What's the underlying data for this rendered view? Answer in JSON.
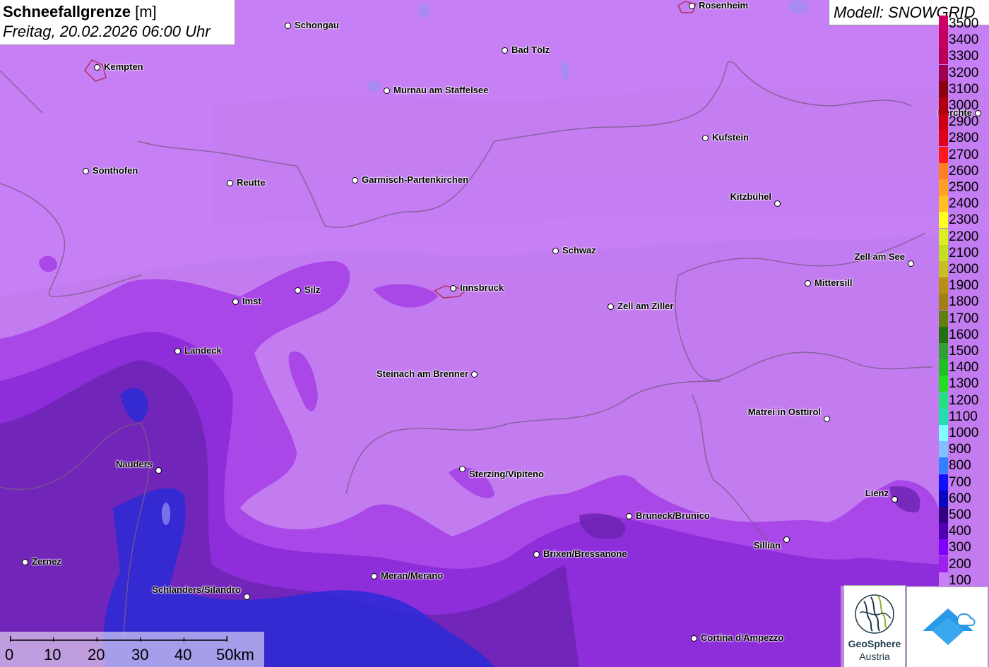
{
  "title": {
    "main": "Schneefallgrenze",
    "unit": "[m]",
    "datetime": "Freitag, 20.02.2026 06:00 Uhr"
  },
  "model": {
    "label": "Modell: SNOWGRID"
  },
  "legend": {
    "items": [
      {
        "label": "3500",
        "color": "#cc0066"
      },
      {
        "label": "3400",
        "color": "#c4005e"
      },
      {
        "label": "3300",
        "color": "#b80058"
      },
      {
        "label": "3200",
        "color": "#a00050"
      },
      {
        "label": "3100",
        "color": "#8a0010"
      },
      {
        "label": "3000",
        "color": "#b00010"
      },
      {
        "label": "2900",
        "color": "#cc0010"
      },
      {
        "label": "2800",
        "color": "#e00018"
      },
      {
        "label": "2700",
        "color": "#ff1a1a"
      },
      {
        "label": "2600",
        "color": "#ff8020"
      },
      {
        "label": "2500",
        "color": "#ffa020"
      },
      {
        "label": "2400",
        "color": "#ffc020"
      },
      {
        "label": "2300",
        "color": "#ffff20"
      },
      {
        "label": "2200",
        "color": "#d8f020"
      },
      {
        "label": "2100",
        "color": "#c0e020"
      },
      {
        "label": "2000",
        "color": "#c8c020"
      },
      {
        "label": "1900",
        "color": "#b89010"
      },
      {
        "label": "1800",
        "color": "#a08010"
      },
      {
        "label": "1700",
        "color": "#608010"
      },
      {
        "label": "1600",
        "color": "#207010"
      },
      {
        "label": "1500",
        "color": "#30a030"
      },
      {
        "label": "1400",
        "color": "#20c020"
      },
      {
        "label": "1300",
        "color": "#20e020"
      },
      {
        "label": "1200",
        "color": "#20e080"
      },
      {
        "label": "1100",
        "color": "#20e0b0"
      },
      {
        "label": "1000",
        "color": "#80ffff"
      },
      {
        "label": "900",
        "color": "#80c0ff"
      },
      {
        "label": "800",
        "color": "#3080ff"
      },
      {
        "label": "700",
        "color": "#1010ff"
      },
      {
        "label": "600",
        "color": "#0808c0"
      },
      {
        "label": "500",
        "color": "#300080"
      },
      {
        "label": "400",
        "color": "#5000b0"
      },
      {
        "label": "300",
        "color": "#8000ff"
      },
      {
        "label": "200",
        "color": "#a020f0"
      },
      {
        "label": "100",
        "color": "#c77ff5"
      }
    ]
  },
  "cities": [
    {
      "name": "Rosenheim"
    },
    {
      "name": "Schongau"
    },
    {
      "name": "Kempten"
    },
    {
      "name": "Bad Tölz"
    },
    {
      "name": "Murnau am Staffelsee"
    },
    {
      "name": "Berchte"
    },
    {
      "name": "Kufstein"
    },
    {
      "name": "Sonthofen"
    },
    {
      "name": "Reutte"
    },
    {
      "name": "Garmisch-Partenkirchen"
    },
    {
      "name": "Kitzbühel"
    },
    {
      "name": "Schwaz"
    },
    {
      "name": "Zell am See"
    },
    {
      "name": "Mittersill"
    },
    {
      "name": "Innsbruck"
    },
    {
      "name": "Silz"
    },
    {
      "name": "Imst"
    },
    {
      "name": "Zell am Ziller"
    },
    {
      "name": "Landeck"
    },
    {
      "name": "Steinach am Brenner"
    },
    {
      "name": "Matrei in Osttirol"
    },
    {
      "name": "Nauders"
    },
    {
      "name": "Sterzing/Vipiteno"
    },
    {
      "name": "Lienz"
    },
    {
      "name": "Bruneck/Brunico"
    },
    {
      "name": "Sillian"
    },
    {
      "name": "Brixen/Bressanone"
    },
    {
      "name": "Zernez"
    },
    {
      "name": "Meran/Merano"
    },
    {
      "name": "Schlanders/Silandro"
    },
    {
      "name": "Cortina d'Ampezzo"
    }
  ],
  "scale": {
    "ticks": [
      "0",
      "10",
      "20",
      "30",
      "40",
      "50km"
    ]
  },
  "logos": {
    "geosphere_name": "GeoSphere",
    "geosphere_sub": "Austria"
  },
  "colors": {
    "map_base": "#c77ff5",
    "level_200": "#a63ee6",
    "level_300": "#8a2ad8",
    "level_400": "#6a24b0",
    "level_600": "#2a2ad6",
    "border_line": "#7a5a8a"
  }
}
